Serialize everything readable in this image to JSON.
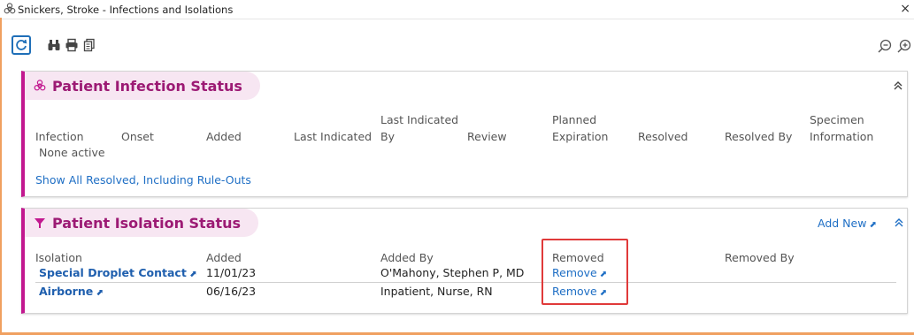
{
  "window": {
    "title": "Snickers, Stroke - Infections and Isolations",
    "close_glyph": "×"
  },
  "toolbar": {
    "icons": [
      "refresh-icon",
      "binoculars-icon",
      "print-icon",
      "copy-icon",
      "zoom-out-icon",
      "zoom-in-icon"
    ]
  },
  "infection": {
    "title": "Patient Infection Status",
    "columns": {
      "infection": "Infection",
      "onset": "Onset",
      "added": "Added",
      "last_indicated": "Last Indicated",
      "last_indicated_by_1": "Last Indicated",
      "last_indicated_by_2": "By",
      "review": "Review",
      "planned_expiration_1": "Planned",
      "planned_expiration_2": "Expiration",
      "resolved": "Resolved",
      "resolved_by": "Resolved By",
      "specimen_1": "Specimen",
      "specimen_2": "Information"
    },
    "empty_text": "None active",
    "show_all_link": "Show All Resolved, Including Rule-Outs"
  },
  "isolation": {
    "title": "Patient Isolation Status",
    "add_new": "Add New",
    "columns": {
      "isolation": "Isolation",
      "added": "Added",
      "added_by": "Added By",
      "removed": "Removed",
      "removed_by": "Removed By"
    },
    "rows": [
      {
        "isolation": "Special Droplet Contact",
        "added": "11/01/23",
        "added_by": "O'Mahony, Stephen P, MD",
        "removed": "Remove"
      },
      {
        "isolation": "Airborne",
        "added": "06/16/23",
        "added_by": "Inpatient, Nurse, RN",
        "removed": "Remove"
      }
    ]
  },
  "colors": {
    "accent_magenta": "#c2188f",
    "header_bg": "#f7e6f2",
    "link_blue": "#1f6fc5",
    "highlight_red": "#e03a3a",
    "window_accent": "#f0a060"
  }
}
